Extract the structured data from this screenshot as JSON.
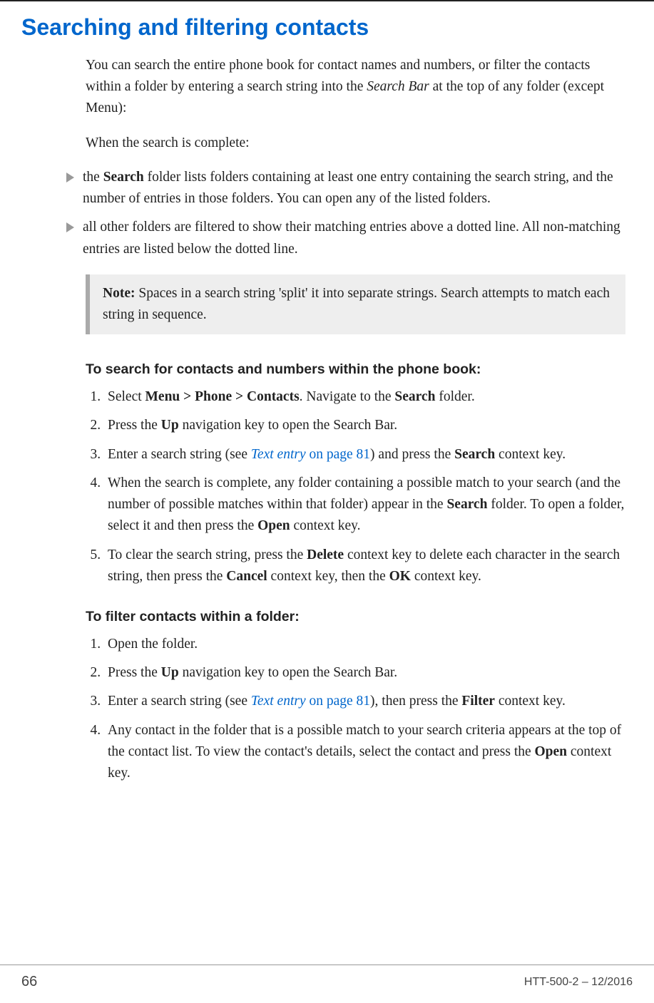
{
  "title": "Searching and filtering contacts",
  "intro": {
    "p1_a": "You can search the entire phone book for contact names and numbers, or filter the contacts within a folder by entering a search string into the ",
    "p1_b": "Search Bar",
    "p1_c": " at the top of any folder (except Menu):",
    "p2": "When the search is complete:"
  },
  "bullets": {
    "b1_a": "the ",
    "b1_b": "Search",
    "b1_c": " folder lists folders containing at least one entry containing the search string, and the number of entries in those folders. You can open any of the listed folders.",
    "b2": "all other folders are filtered to show their matching entries above a dotted line. All non-matching entries are listed below the dotted line."
  },
  "note": {
    "label": "Note:",
    "text": "  Spaces in a search string 'split' it into separate strings. Search attempts to match each string in sequence."
  },
  "search_section": {
    "heading": "To search for contacts and numbers within the phone book:",
    "steps": {
      "s1_a": "Select ",
      "s1_b": "Menu > Phone > Contacts",
      "s1_c": ". Navigate to the ",
      "s1_d": "Search",
      "s1_e": " folder.",
      "s2_a": "Press the ",
      "s2_b": "Up",
      "s2_c": " navigation key to open the Search Bar.",
      "s3_a": "Enter a search string (see ",
      "s3_link1": "Text entry",
      "s3_link2": " on page 81",
      "s3_b": ") and press the ",
      "s3_c": "Search",
      "s3_d": " context key.",
      "s4_a": "When the search is complete, any folder containing a possible match to your search (and the number of possible matches within that folder) appear in the ",
      "s4_b": "Search",
      "s4_c": " folder. To open a folder, select it and then press the ",
      "s4_d": "Open",
      "s4_e": " context key.",
      "s5_a": "To clear the search string, press the ",
      "s5_b": "Delete",
      "s5_c": " context key to delete each character in the search string, then press the ",
      "s5_d": "Cancel",
      "s5_e": " context key, then the ",
      "s5_f": "OK",
      "s5_g": " context key."
    }
  },
  "filter_section": {
    "heading": "To filter contacts within a folder:",
    "steps": {
      "s1": "Open the folder.",
      "s2_a": "Press the ",
      "s2_b": "Up",
      "s2_c": " navigation key to open the Search Bar.",
      "s3_a": "Enter a search string (see ",
      "s3_link1": "Text entry",
      "s3_link2": " on page 81",
      "s3_b": "), then press the ",
      "s3_c": "Filter",
      "s3_d": " context key.",
      "s4_a": "Any contact in the folder that is a possible match to your search criteria appears at the top of the contact list. To view the contact's details, select the contact and press the ",
      "s4_b": "Open",
      "s4_c": " context key."
    }
  },
  "footer": {
    "page": "66",
    "docid": "HTT-500-2 – 12/2016"
  }
}
